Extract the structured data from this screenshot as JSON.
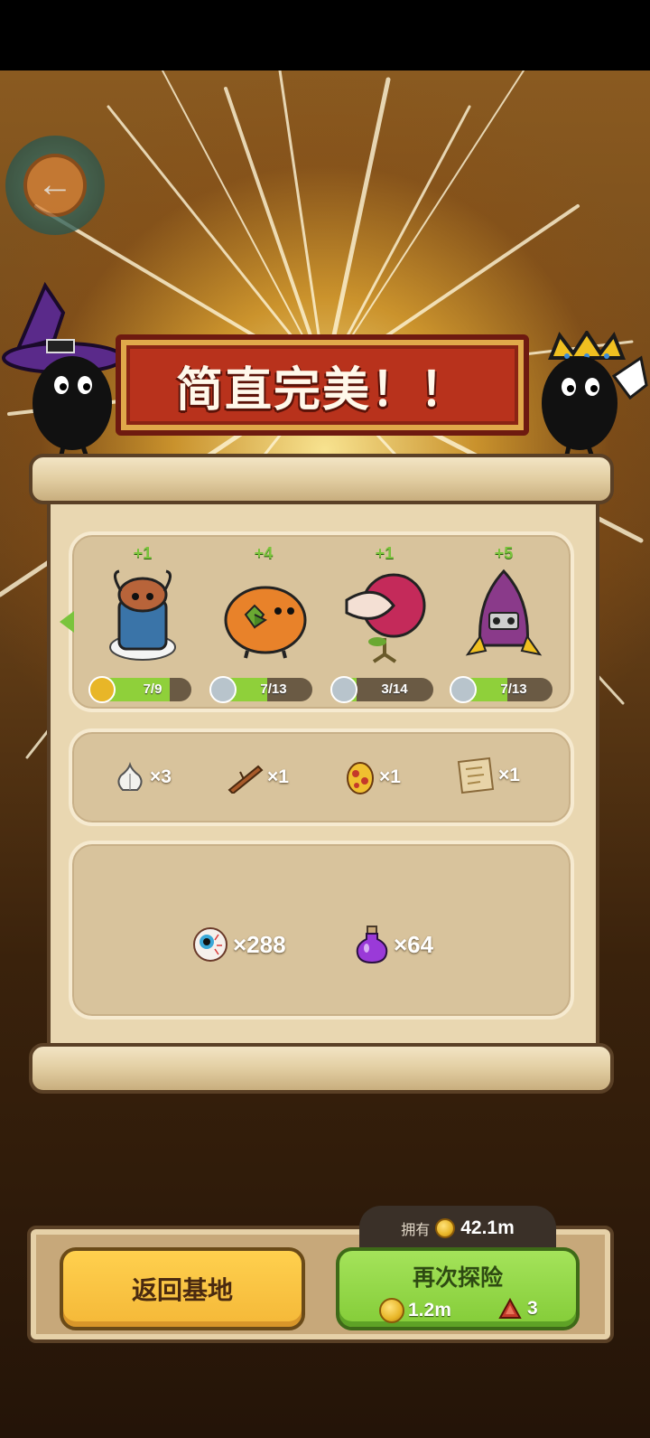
{
  "banner": {
    "title": "简直完美！！"
  },
  "monsters": [
    {
      "gain": "+1",
      "progress_text": "7/9",
      "progress": 0.78,
      "badge_color": "#e8b628",
      "name_icon": "masked-monster-icon"
    },
    {
      "gain": "+4",
      "progress_text": "7/13",
      "progress": 0.54,
      "badge_color": "#b8c4cc",
      "name_icon": "orange-blob-monster-icon"
    },
    {
      "gain": "+1",
      "progress_text": "3/14",
      "progress": 0.21,
      "badge_color": "#b8c4cc",
      "name_icon": "carnivorous-plant-monster-icon"
    },
    {
      "gain": "+5",
      "progress_text": "7/13",
      "progress": 0.54,
      "badge_color": "#b8c4cc",
      "name_icon": "rocket-monster-icon"
    }
  ],
  "items": [
    {
      "icon": "garlic-icon",
      "qty": "×3"
    },
    {
      "icon": "wood-stick-icon",
      "qty": "×1"
    },
    {
      "icon": "spotted-egg-icon",
      "qty": "×1"
    },
    {
      "icon": "map-scroll-icon",
      "qty": "×1"
    }
  ],
  "resources": [
    {
      "icon": "eyeball-icon",
      "qty": "×288"
    },
    {
      "icon": "purple-potion-icon",
      "qty": "×64"
    }
  ],
  "owned": {
    "label": "拥有",
    "value": "42.1m"
  },
  "buttons": {
    "home": "返回基地",
    "again": "再次探险",
    "again_coin_cost": "1.2m",
    "again_energy_cost": "3"
  },
  "colors": {
    "accent_green": "#8fd03a",
    "banner_red": "#b8321c",
    "button_yellow": "#f4b838"
  }
}
